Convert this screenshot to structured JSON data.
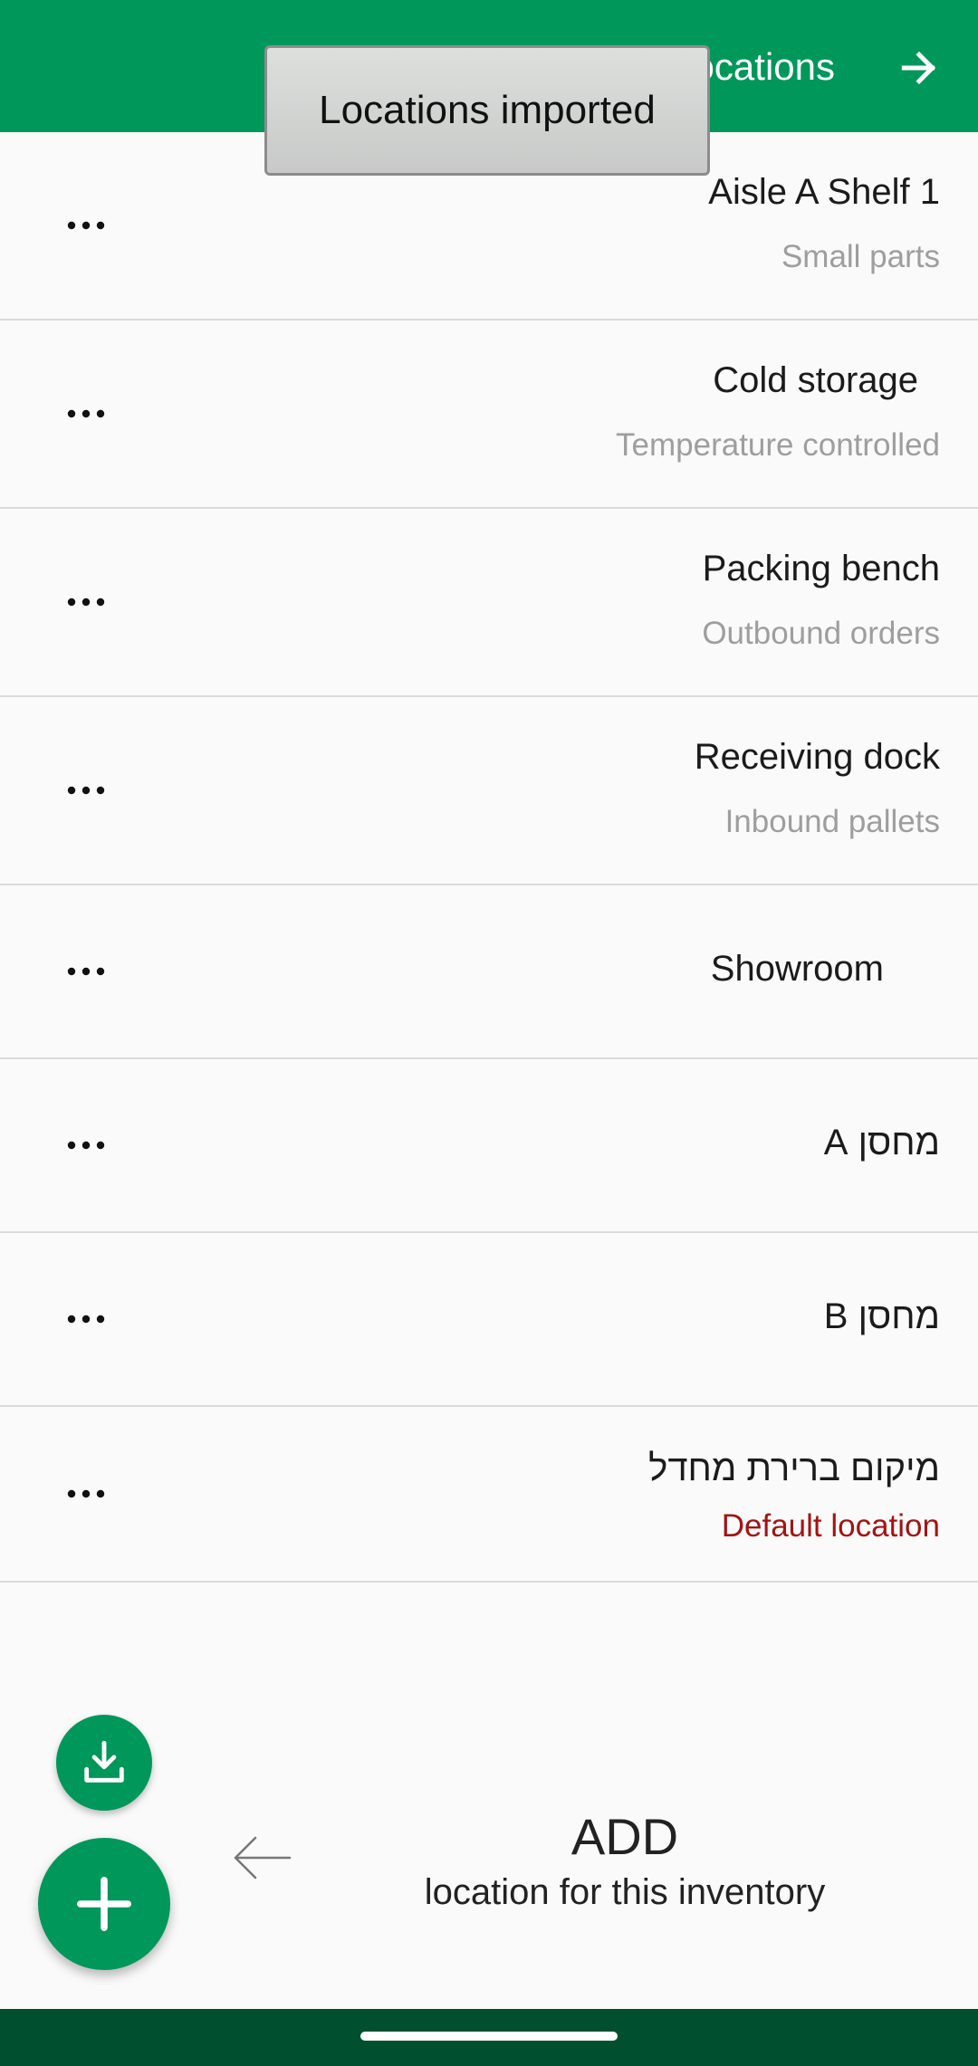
{
  "appbar": {
    "title": "Locations",
    "back_icon": "arrow-right-icon"
  },
  "toast": {
    "text": "Locations imported"
  },
  "locations": [
    {
      "name": "Aisle A Shelf 1",
      "subtitle": "Small parts"
    },
    {
      "name": "Cold storage",
      "subtitle": "Temperature controlled"
    },
    {
      "name": "Packing bench",
      "subtitle": "Outbound orders"
    },
    {
      "name": "Receiving dock",
      "subtitle": "Inbound pallets"
    },
    {
      "name": "Showroom",
      "subtitle": ""
    },
    {
      "name": "מחסן A",
      "subtitle": ""
    },
    {
      "name": "מחסן B",
      "subtitle": ""
    },
    {
      "name": "מיקום ברירת מחדל",
      "subtitle": "Default location"
    }
  ],
  "hint": {
    "title": "ADD",
    "subtitle": "location for this inventory"
  },
  "colors": {
    "primary": "#00975a",
    "nav_bar": "#004f2f",
    "default_label": "#a31414"
  }
}
